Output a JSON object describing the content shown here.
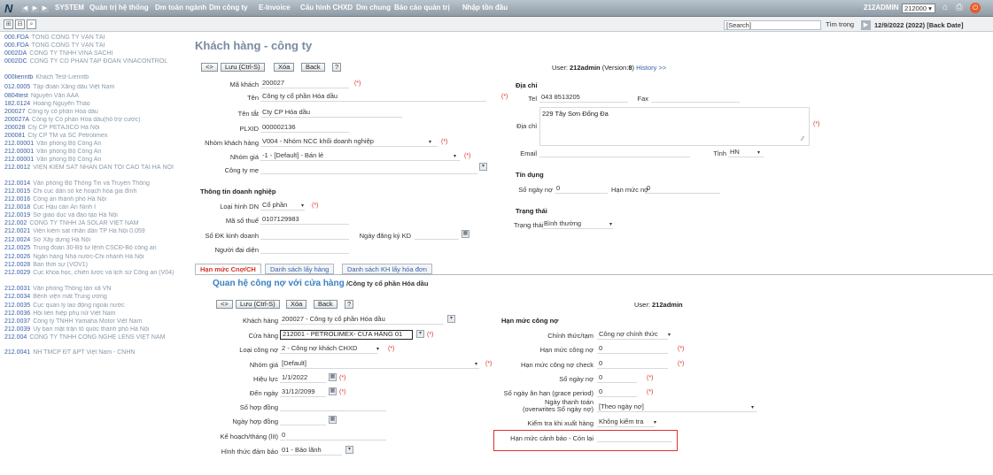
{
  "topbar": {
    "menu": [
      "SYSTEM",
      "Quản trị hệ thống",
      "Dm toàn ngành",
      "Dm công ty",
      "E-Invoice",
      "Cấu hình CHXD",
      "Dm chung",
      "Báo cáo quản trị",
      "Nhập tồn đầu"
    ],
    "user": "212ADMIN",
    "company_select": "212000"
  },
  "toolbar2": {
    "search": "[Search]",
    "search_scope": "Tìm trong",
    "date": "12/9/2022 (2022) [Back Date]"
  },
  "left_list": [
    {
      "code": "000.FDA",
      "name": "TỔNG CÔNG TY VẬN TẢI"
    },
    {
      "code": "000.FDA",
      "name": "TỔNG CÔNG TY VẬN TẢI"
    },
    {
      "code": "0002DA",
      "name": "CÔNG TY TNHH VINA SACHI"
    },
    {
      "code": "0002DC",
      "name": "CÔNG TY CỔ PHẦN TẬP ĐOÀN VINACONTROL"
    },
    {
      "code": "000lienntb",
      "name": "Khách Test-Lienntb"
    },
    {
      "code": "012.0005",
      "name": "Tập đoàn Xăng dầu Việt Nam"
    },
    {
      "code": "0804test",
      "name": "Nguyễn Văn AAA"
    },
    {
      "code": "182.0124",
      "name": "Hoàng Nguyên Thảo"
    },
    {
      "code": "200027",
      "name": "Công ty cổ phần Hóa dầu"
    },
    {
      "code": "200027A",
      "name": "Công ty Cổ phần Hóa dầu(hỗ trợ cước)"
    },
    {
      "code": "200028",
      "name": "Cty CP PETAJICO Hà Nội"
    },
    {
      "code": "200081",
      "name": "Cty CP TM và SC Petrolimex"
    },
    {
      "code": "212.00001",
      "name": "Văn phòng Bộ Công An"
    },
    {
      "code": "212.00001",
      "name": "Văn phòng Bộ Công An"
    },
    {
      "code": "212.00001",
      "name": "Văn phòng Bộ Công An"
    },
    {
      "code": "212.0012",
      "name": "VIỆN KIỂM SÁT NHÂN DÂN TỐI CAO TẠI HÀ NỘI"
    },
    {
      "code": "212.0014",
      "name": "Văn phòng Bộ Thông Tin và Truyền Thông"
    },
    {
      "code": "212.0015",
      "name": "Chi cục dân số kế hoạch hóa gia đình"
    },
    {
      "code": "212.0016",
      "name": "Công an thành phố Hà Nội"
    },
    {
      "code": "212.0018",
      "name": "Cục Hậu cần An Ninh I"
    },
    {
      "code": "212.0019",
      "name": "Sở giáo dục và đào tạo Hà Nội"
    },
    {
      "code": "212.002",
      "name": "CÔNG TY TNHH JA SOLAR VIỆT NAM"
    },
    {
      "code": "212.0021",
      "name": "Viện kiểm sát nhân dân TP Hà Nội 0.059"
    },
    {
      "code": "212.0024",
      "name": "Sở Xây dựng Hà Nội"
    },
    {
      "code": "212.0025",
      "name": "Trung đoàn 30-Bộ tư lệnh CSCĐ-Bộ công an"
    },
    {
      "code": "212.0026",
      "name": "Ngân hàng Nhà nước-Chi nhánh Hà Nội"
    },
    {
      "code": "212.0028",
      "name": "Ban thời sự (VOV1)"
    },
    {
      "code": "212.0029",
      "name": "Cục khoa học, chiến lược và lịch sử Công an (V04)"
    },
    {
      "code": "212.0031",
      "name": "Văn phòng Thông tấn xã VN"
    },
    {
      "code": "212.0034",
      "name": "Bệnh viện mắt Trung ương"
    },
    {
      "code": "212.0035",
      "name": "Cục quản lý lao động ngoài nước"
    },
    {
      "code": "212.0036",
      "name": "Hội liên hiệp phụ nữ Việt Nam"
    },
    {
      "code": "212.0037",
      "name": "Công ty TNHH Yamaha Motor Việt Nam"
    },
    {
      "code": "212.0039",
      "name": "Ủy ban mặt trận tổ quốc thành phố Hà Nội"
    },
    {
      "code": "212.004",
      "name": "CÔNG TY TNHH CÔNG NGHỆ LENS VIỆT NAM"
    },
    {
      "code": "212.0041",
      "name": "NH TMCP ĐT &PT Việt Nam - CNHN"
    }
  ],
  "form": {
    "title": "Khách hàng - công ty",
    "btn_swap": "<>",
    "btn_save": "Lưu (Ctrl-S)",
    "btn_delete": "Xóa",
    "btn_back": "Back",
    "btn_help": "?",
    "user_prefix": "User:",
    "user": "212admin",
    "version_prefix": "(Version:",
    "version": "8",
    "version_suffix": ")",
    "history": "History >>",
    "fields": {
      "ma_khach": {
        "label": "Mã khách",
        "value": "200027"
      },
      "ten": {
        "label": "Tên",
        "value": "Công ty cổ phần Hóa dầu"
      },
      "ten_tat": {
        "label": "Tên tắt",
        "value": "Cty CP Hóa dầu"
      },
      "plxid": {
        "label": "PLXID",
        "value": "000002136"
      },
      "nhom_kh": {
        "label": "Nhóm khách hàng",
        "value": "V004 - Nhóm NCC khối doanh nghiệp"
      },
      "nhom_gia": {
        "label": "Nhóm giá",
        "value": "-1 - [Default] - Bán lẻ"
      },
      "cong_ty_me": {
        "label": "Công ty mẹ",
        "value": ""
      }
    },
    "tt_dn_title": "Thông tin doanh nghiệp",
    "loai_hinh": {
      "label": "Loại hình DN",
      "value": "Cổ phần"
    },
    "mst": {
      "label": "Mã số thuế",
      "value": "0107129983"
    },
    "so_dk": {
      "label": "Số ĐK kinh doanh",
      "value": ""
    },
    "ngay_dk": {
      "label": "Ngày đăng ký KD",
      "value": ""
    },
    "nguoi_dd": {
      "label": "Người đại diện",
      "value": ""
    },
    "dia_chi_title": "Địa chỉ",
    "tel": {
      "label": "Tel",
      "value": "043 8513205"
    },
    "fax": {
      "label": "Fax",
      "value": ""
    },
    "dia_chi": {
      "label": "Địa chỉ",
      "value": "229 Tây Sơn Đống Đa"
    },
    "email": {
      "label": "Email",
      "value": ""
    },
    "tinh": {
      "label": "Tỉnh",
      "value": "HN"
    },
    "tin_dung_title": "Tín dụng",
    "so_ngay_no": {
      "label": "Số ngày nợ",
      "value": "0"
    },
    "han_muc_no": {
      "label": "Hạn mức nợ",
      "value": "0"
    },
    "trang_thai_title": "Trạng thái",
    "trang_thai": {
      "label": "Trạng thái",
      "value": "Bình thường"
    },
    "req": "(*)"
  },
  "tabs": [
    "Hạn mức Cnợ/CH",
    "Danh sách lấy hàng",
    "Danh sách KH lấy hóa đơn"
  ],
  "sub": {
    "title": "Quan hệ công nợ với cửa hàng",
    "title_suffix": "/Công ty cổ phần Hóa dầu",
    "user_prefix": "User:",
    "user": "212admin",
    "khach_hang": {
      "label": "Khách hàng",
      "value": "200027 - Công ty cổ phần Hóa dầu"
    },
    "cua_hang": {
      "label": "Cửa hàng",
      "value": "212001 - PETROLIMEX- CỬA HÀNG 01"
    },
    "loai_cong_no": {
      "label": "Loại công nợ",
      "value": "2 - Công nợ khách CHXD"
    },
    "nhom_gia": {
      "label": "Nhóm giá",
      "value": "[Default]"
    },
    "hieu_luc": {
      "label": "Hiệu lực",
      "value": "1/1/2022"
    },
    "den_ngay": {
      "label": "Đến ngày",
      "value": "31/12/2099"
    },
    "so_hop_dong": {
      "label": "Số hợp đồng",
      "value": ""
    },
    "ngay_hop_dong": {
      "label": "Ngày hợp đồng",
      "value": ""
    },
    "ke_hoach": {
      "label": "Kế hoạch/tháng (lít)",
      "value": "0"
    },
    "hinh_thuc": {
      "label": "Hình thức đảm bảo",
      "value": "01 - Bảo lãnh"
    },
    "hm_title": "Hạn mức công nợ",
    "chinh_thuc": {
      "label": "Chính thức/tạm",
      "value": "Công nợ chính thức"
    },
    "hm_cong_no": {
      "label": "Hạn mức công nợ",
      "value": "0"
    },
    "hm_check": {
      "label": "Hạn mức công nợ check",
      "value": "0"
    },
    "so_ngay_no": {
      "label": "Số ngày nợ",
      "value": "0"
    },
    "so_ngay_an_han": {
      "label": "Số ngày ân hạn (grace period)",
      "value": "0"
    },
    "ngay_tt_label1": "Ngày thanh toán",
    "ngay_tt_label2": "(overwrites Số ngày nợ)",
    "ngay_tt_value": "[Theo ngày nợ]",
    "kiem_tra": {
      "label": "Kiểm tra khi xuất hàng",
      "value": "Không kiểm tra"
    },
    "canh_bao": {
      "label": "Hạn mức cảnh báo - Còn lại",
      "value": ""
    }
  },
  "colors": {
    "accent": "#3a5fa8",
    "required": "#d93025",
    "highlight_box": "#e03030"
  }
}
